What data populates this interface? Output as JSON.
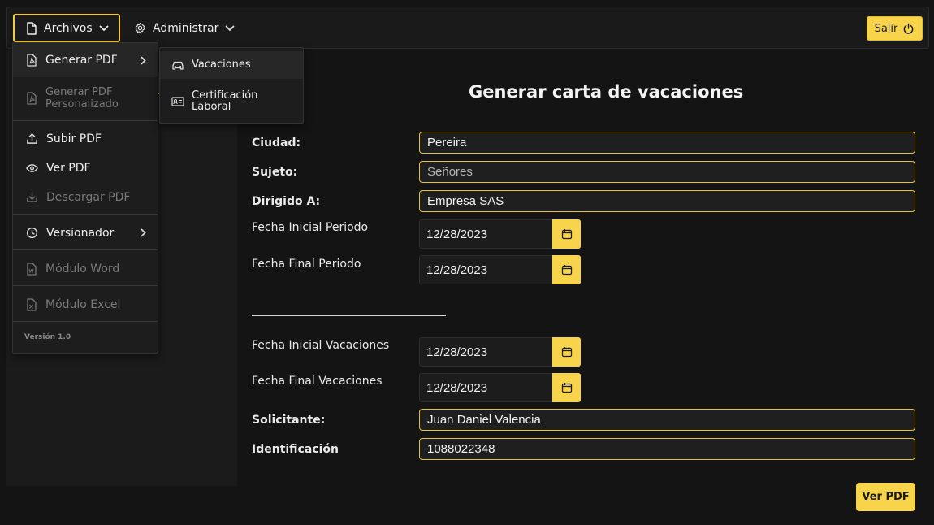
{
  "nav": {
    "archivos": "Archivos",
    "administrar": "Administrar",
    "salir": "Salir"
  },
  "menu": {
    "generar_pdf": "Generar PDF",
    "generar_pdf_personalizado": "Generar PDF Personalizado",
    "subir_pdf": "Subir PDF",
    "ver_pdf": "Ver PDF",
    "descargar_pdf": "Descargar PDF",
    "versionador": "Versionador",
    "modulo_word": "Módulo Word",
    "modulo_excel": "Módulo Excel",
    "version": "Versión 1.0"
  },
  "submenu": {
    "vacaciones": "Vacaciones",
    "certificacion_laboral": "Certificación Laboral"
  },
  "form": {
    "title": "Generar carta de vacaciones",
    "ciudad_label": "Ciudad:",
    "ciudad_value": "Pereira",
    "sujeto_label": "Sujeto:",
    "sujeto_placeholder": "Señores",
    "dirigido_label": "Dirigido A:",
    "dirigido_value": "Empresa SAS",
    "fecha_inicial_periodo_label": "Fecha Inicial Periodo",
    "fecha_inicial_periodo_value": "12/28/2023",
    "fecha_final_periodo_label": "Fecha Final Periodo",
    "fecha_final_periodo_value": "12/28/2023",
    "fecha_inicial_vacaciones_label": "Fecha Inicial Vacaciones",
    "fecha_inicial_vacaciones_value": "12/28/2023",
    "fecha_final_vacaciones_label": "Fecha Final Vacaciones",
    "fecha_final_vacaciones_value": "12/28/2023",
    "solicitante_label": "Solicitante:",
    "solicitante_value": "Juan Daniel Valencia",
    "identificacion_label": "Identificación",
    "identificacion_value": "1088022348",
    "ver_pdf_button": "Ver PDF"
  },
  "colors": {
    "accent": "#f8d44a",
    "background": "#141414",
    "panel": "#1b1b1b"
  }
}
